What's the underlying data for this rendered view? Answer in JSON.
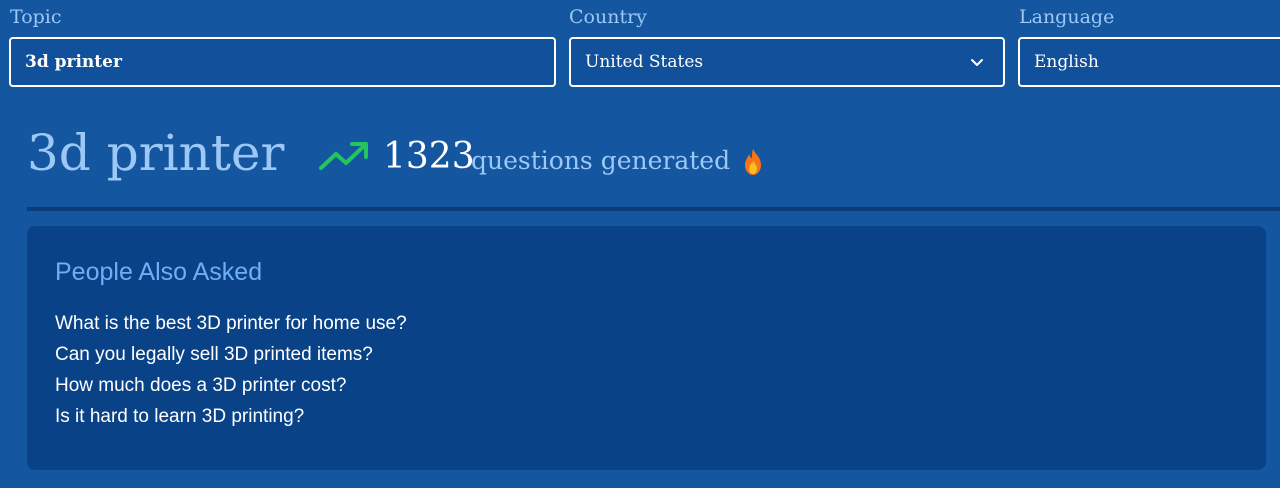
{
  "filters": {
    "topic": {
      "label": "Topic",
      "value": "3d printer"
    },
    "country": {
      "label": "Country",
      "value": "United States",
      "icon": "chevron-down-icon"
    },
    "language": {
      "label": "Language",
      "value": "English"
    }
  },
  "heading": {
    "title": "3d printer",
    "trend_icon": "trending-up-icon",
    "trend_color": "#22c55e",
    "count": "1323",
    "count_label": "questions generated",
    "fire_icon": "fire-icon"
  },
  "people_also_asked": {
    "title": "People Also Asked",
    "questions": [
      "What is the best 3D printer for home use?",
      "Can you legally sell 3D printed items?",
      "How much does a 3D printer cost?",
      "Is it hard to learn 3D printing?"
    ]
  },
  "colors": {
    "background": "#1556a0",
    "card": "#0a4288",
    "accent_text": "#9cc7f7",
    "paa_title": "#6eaef2"
  }
}
